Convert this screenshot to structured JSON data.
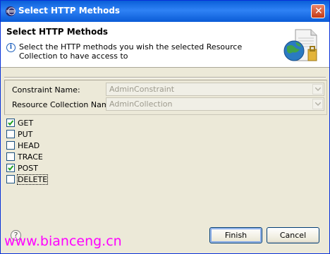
{
  "window": {
    "title": "Select HTTP Methods",
    "icon": "eclipse-icon",
    "close_label": "✕"
  },
  "header": {
    "title": "Select HTTP Methods",
    "message": "Select the HTTP methods you wish the selected Resource Collection to have access to",
    "info_icon": "i",
    "banner_icon": "globe-document-icon"
  },
  "form": {
    "constraint_label": "Constraint Name:",
    "constraint_value": "AdminConstraint",
    "collection_label": "Resource Collection Name:",
    "collection_value": "AdminCollection"
  },
  "methods": [
    {
      "label": "GET",
      "checked": true
    },
    {
      "label": "PUT",
      "checked": false
    },
    {
      "label": "HEAD",
      "checked": false
    },
    {
      "label": "TRACE",
      "checked": false
    },
    {
      "label": "POST",
      "checked": true
    },
    {
      "label": "DELETE",
      "checked": false
    }
  ],
  "footer": {
    "help_label": "?",
    "finish_label": "Finish",
    "cancel_label": "Cancel"
  },
  "watermark": "www.bianceng.cn",
  "colors": {
    "titlebar": "#0a5fd8",
    "dialog_bg": "#ece9d8",
    "check": "#21a121",
    "watermark": "#ff00ff"
  }
}
